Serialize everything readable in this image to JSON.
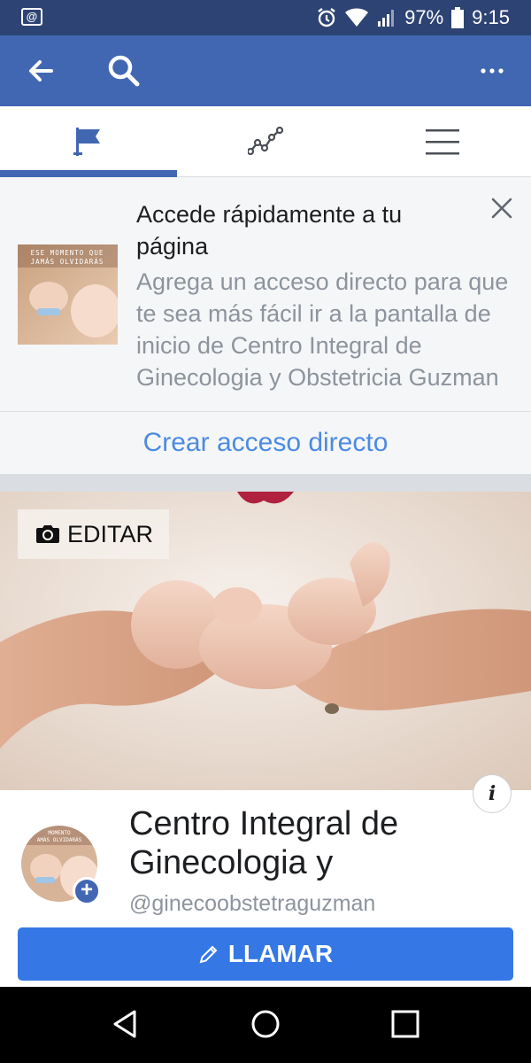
{
  "status_bar": {
    "battery": "97%",
    "time": "9:15",
    "notification_icon": "at-sign-icon"
  },
  "app_bar": {
    "back_icon": "arrow-left-icon",
    "search_icon": "search-icon",
    "more_icon": "more-dots-icon"
  },
  "tabs": [
    {
      "icon": "flag-icon",
      "active": true
    },
    {
      "icon": "insights-icon",
      "active": false
    },
    {
      "icon": "menu-icon",
      "active": false
    }
  ],
  "shortcut_banner": {
    "title": "Accede rápidamente a tu página",
    "description": "Agrega un acceso directo para que te sea más fácil ir a la pantalla de inicio de Centro Integral de Ginecologia y Obstetricia Guzman",
    "cta": "Crear acceso directo",
    "thumb_text": "ESE MOMENTO QUE JAMÁS OLVIDARÁS"
  },
  "cover": {
    "edit_label": "EDITAR"
  },
  "profile": {
    "name": "Centro Integral de Ginecologia y",
    "handle": "@ginecoobstetraguzman",
    "call_label": "LLAMAR"
  },
  "colors": {
    "status_bar": "#2d4373",
    "app_bar": "#4267b2",
    "accent": "#3578e5",
    "link": "#4c8be0"
  }
}
